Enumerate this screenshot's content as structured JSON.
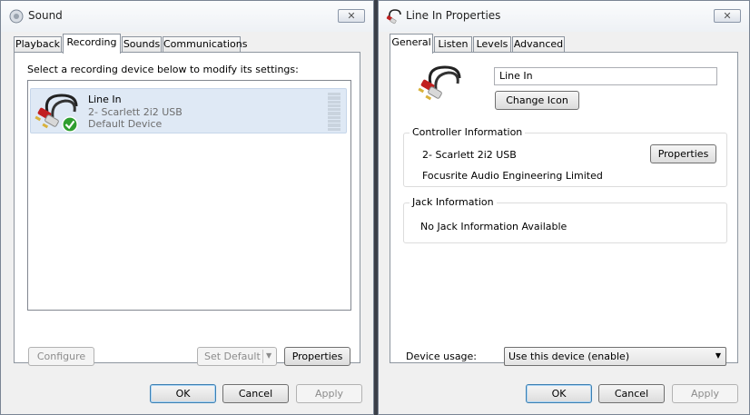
{
  "sound_window": {
    "title": "Sound",
    "close_label": "✕",
    "tabs": [
      {
        "label": "Playback"
      },
      {
        "label": "Recording"
      },
      {
        "label": "Sounds"
      },
      {
        "label": "Communications"
      }
    ],
    "instruction": "Select a recording device below to modify its settings:",
    "device": {
      "name": "Line In",
      "subtitle": "2- Scarlett 2i2 USB",
      "status": "Default Device",
      "level_segments": 10
    },
    "buttons": {
      "configure": "Configure",
      "set_default": "Set Default",
      "properties": "Properties",
      "ok": "OK",
      "cancel": "Cancel",
      "apply": "Apply"
    },
    "colors": {
      "selected_row": "#dfe9f5",
      "check": "#2f9e2f"
    }
  },
  "props_window": {
    "title": "Line In Properties",
    "close_label": "✕",
    "tabs": [
      {
        "label": "General"
      },
      {
        "label": "Listen"
      },
      {
        "label": "Levels"
      },
      {
        "label": "Advanced"
      }
    ],
    "device_name_value": "Line In",
    "change_icon_label": "Change Icon",
    "controller": {
      "heading": "Controller Information",
      "device": "2- Scarlett 2i2 USB",
      "manufacturer": "Focusrite Audio Engineering Limited",
      "properties_label": "Properties"
    },
    "jack": {
      "heading": "Jack Information",
      "text": "No Jack Information Available"
    },
    "device_usage": {
      "label": "Device usage:",
      "value": "Use this device (enable)"
    },
    "buttons": {
      "ok": "OK",
      "cancel": "Cancel",
      "apply": "Apply"
    }
  }
}
